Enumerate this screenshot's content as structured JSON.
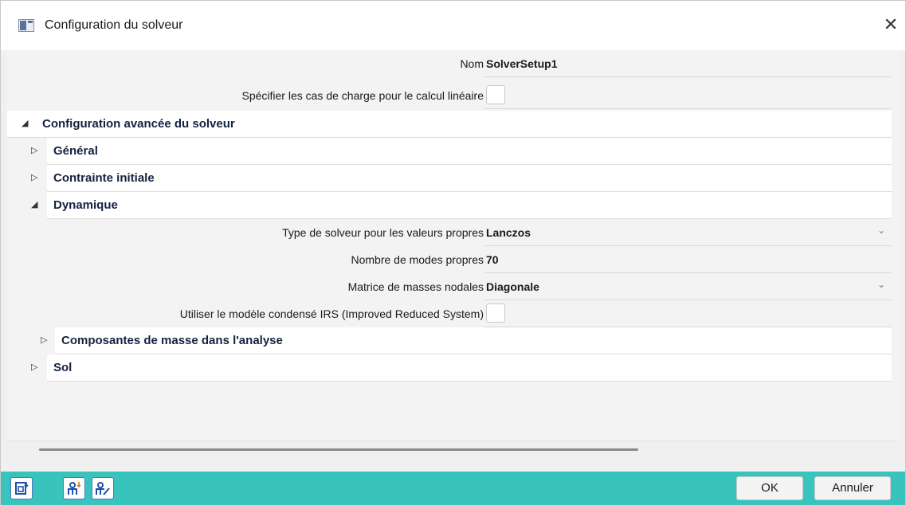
{
  "window": {
    "title": "Configuration du solveur",
    "close_label": "✕"
  },
  "properties": {
    "name_label": "Nom",
    "name_value": "SolverSetup1",
    "load_cases_label": "Spécifier les cas de charge pour le calcul linéaire",
    "load_cases_checked": false
  },
  "advanced": {
    "label": "Configuration avancée du solveur",
    "expanded_icon": "◢",
    "groups": {
      "general": {
        "label": "Général",
        "icon": "▷"
      },
      "initial_stress": {
        "label": "Contrainte initiale",
        "icon": "▷"
      },
      "dynamics": {
        "label": "Dynamique",
        "icon": "◢",
        "eigen_solver_label": "Type de solveur pour les valeurs propres",
        "eigen_solver_value": "Lanczos",
        "num_modes_label": "Nombre de modes propres",
        "num_modes_value": "70",
        "mass_matrix_label": "Matrice de masses nodales",
        "mass_matrix_value": "Diagonale",
        "irs_label": "Utiliser le modèle condensé IRS (Improved Reduced System)",
        "irs_checked": false,
        "mass_components": {
          "label": "Composantes de masse dans l'analyse",
          "icon": "▷"
        }
      },
      "soil": {
        "label": "Sol",
        "icon": "▷"
      }
    }
  },
  "dropdown_icon": "⌄",
  "footer": {
    "ok_label": "OK",
    "cancel_label": "Annuler",
    "accent_color": "#38c4bd"
  },
  "icons": [
    "window-app-icon",
    "close-icon",
    "expand-icon",
    "collapse-icon",
    "dropdown-arrow-icon",
    "document-import-icon",
    "user-import-icon",
    "user-edit-icon"
  ]
}
